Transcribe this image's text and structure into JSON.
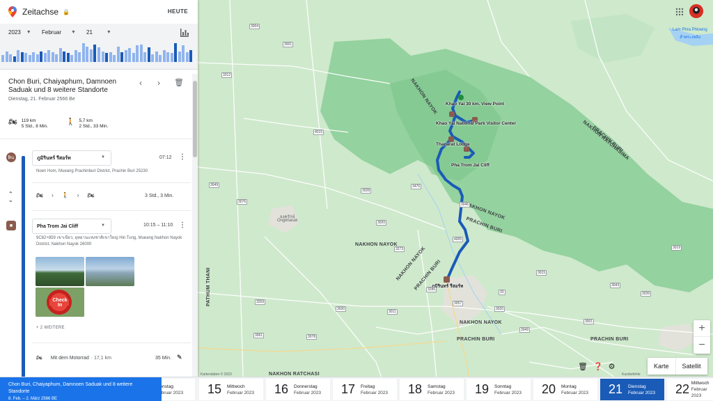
{
  "header": {
    "title": "Zeitachse",
    "today_label": "HEUTE"
  },
  "selectors": {
    "year": "2023",
    "month": "Februar",
    "day": "21"
  },
  "histogram_levels": [
    0.35,
    0.55,
    0.4,
    0.3,
    0.6,
    0.5,
    0.45,
    0.35,
    0.5,
    0.4,
    0.55,
    0.45,
    0.6,
    0.5,
    0.4,
    0.7,
    0.55,
    0.45,
    0.35,
    0.6,
    0.5,
    0.95,
    0.8,
    0.65,
    0.9,
    0.75,
    0.55,
    0.45,
    0.5,
    0.35,
    0.8,
    0.5,
    0.6,
    0.7,
    0.45,
    0.85,
    0.9,
    0.5,
    0.75,
    0.4,
    0.55,
    0.35,
    0.6,
    0.5,
    0.45,
    0.95,
    0.55,
    0.85,
    0.5,
    0.6
  ],
  "trip": {
    "title": "Chon Buri, Chaiyaphum, Damnoen Saduak und 8 weitere Standorte",
    "date": "Dienstag, 21. Februar 2566 Be",
    "motorbike_distance": "119 km",
    "motorbike_time": "5 Std., 8 Min.",
    "walk_distance": "5,7 km",
    "walk_time": "2 Std., 33 Min."
  },
  "timeline": {
    "place1": {
      "name": "ภูมิรินทร์ รีสอร์ท",
      "time": "07:12",
      "address": "Noen Hom, Mueang Prachinburi District, Prachin Buri 25230"
    },
    "segment1": {
      "duration": "3 Std., 3 Min."
    },
    "place2": {
      "name": "Pha Trom Jai Cliff",
      "time": "10:15 – 11:10",
      "address": "9C82+859 เขาเขียว, อุทยานแห่งชาติเขาใหญ่ Hin Tung, Mueang Nakhon Nayok District, Nakhon Nayok 26000",
      "more": "+ 2 WEITERE",
      "stamp": "Check In"
    },
    "segment2": {
      "mode": "Mit dem Motorrad",
      "distance": "· 17,1 km",
      "duration": "35 Min."
    }
  },
  "map": {
    "labels": {
      "nakhon_ratchasima": "NAKHON RATCHASIMA",
      "prachin_buri_ne": "PRACHIN BURI",
      "nakhon_nayok_1": "NAKHON NAYOK",
      "prachin_buri_1": "PRACHIN BURI",
      "nakhon_nayok_2": "NAKHON NAYOK",
      "nakhon_nayok_3": "NAKHON NAYOK",
      "prachin_buri_2": "PRACHIN BURI",
      "nakhon_nayok_4": "NAKHON NAYOK",
      "prachin_buri_3": "PRACHIN BURI",
      "prachin_buri_4": "PRACHIN BURI",
      "pathum_thani": "PATHUM THANI",
      "nakhon_ratchasima_w": "NAKHON RATCHASI",
      "nakhon_nayok_5": "NAKHON NAYOK",
      "lam_phra": "Lam Phra Phloeng",
      "lam_phra_th": "ลำพระเพลิง"
    },
    "pois": {
      "view_point": "Khao Yai 30 km. View Point",
      "visitor_center": "Khao Yai National Park Visitor Center",
      "lodge": "Thanarat Lodge",
      "cliff": "Pha Trom Jai Cliff",
      "resort": "ภูมิรินทร์ รีสอร์ท"
    },
    "towns": {
      "t1": "องครักษ์",
      "t2": "Ongkharak"
    },
    "shields": [
      "3004",
      "3001",
      "3312",
      "4015",
      "3049",
      "3076",
      "3028",
      "3476",
      "3020",
      "3273",
      "4005",
      "3020",
      "3049",
      "3001",
      "33",
      "3057",
      "3286",
      "3011",
      "3030",
      "3259",
      "3061",
      "3078",
      "3039",
      "3019",
      "3043",
      "3015",
      "3046"
    ],
    "copyright": "Kartendaten © 2023",
    "shortcuts": "Kurzbefehle",
    "map_type": {
      "map": "Karte",
      "satellite": "Satellit"
    }
  },
  "bottom": {
    "banner_title": "Chon Buri, Chaiyaphum, Damnoen Saduak und 8 weitere Standorte",
    "banner_range": "8. Feb. – 2. März 2566 BE",
    "days": [
      {
        "num": "",
        "name": "ienstag",
        "month": "ebruar 2023"
      },
      {
        "num": "15",
        "name": "Mittwoch",
        "month": "Februar 2023"
      },
      {
        "num": "16",
        "name": "Donnerstag",
        "month": "Februar 2023"
      },
      {
        "num": "17",
        "name": "Freitag",
        "month": "Februar 2023"
      },
      {
        "num": "18",
        "name": "Samstag",
        "month": "Februar 2023"
      },
      {
        "num": "19",
        "name": "Sonntag",
        "month": "Februar 2023"
      },
      {
        "num": "20",
        "name": "Montag",
        "month": "Februar 2023"
      },
      {
        "num": "21",
        "name": "Dienstag",
        "month": "Februar 2023"
      },
      {
        "num": "22",
        "name": "Mittwoch",
        "month": "Februar 2023"
      }
    ]
  },
  "colors": {
    "route": "#1a5bb7",
    "park": "#8dcf9a",
    "land": "#cfe9cc",
    "accent": "#1a73e8"
  }
}
